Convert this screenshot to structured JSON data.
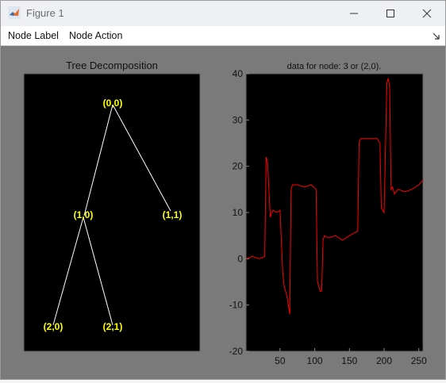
{
  "window": {
    "title": "Figure 1",
    "icon": "matlab-icon",
    "controls": [
      "minimize-icon",
      "maximize-icon",
      "close-icon"
    ]
  },
  "menu": {
    "items": [
      {
        "label": "Node Label"
      },
      {
        "label": "Node Action"
      }
    ],
    "dock_icon": "dock-arrow-icon"
  },
  "colors": {
    "figure_bg": "#7a7a7a",
    "axes_bg": "#000000",
    "node_label": "#ffff00",
    "tree_edge": "#ffffff",
    "signal": "#ff0000"
  },
  "tree": {
    "title": "Tree Decomposition",
    "nodes": [
      "(0,0)",
      "(1,0)",
      "(1,1)",
      "(2,0)",
      "(2,1)"
    ],
    "edges": [
      [
        "(0,0)",
        "(1,0)"
      ],
      [
        "(0,0)",
        "(1,1)"
      ],
      [
        "(1,0)",
        "(2,0)"
      ],
      [
        "(1,0)",
        "(2,1)"
      ]
    ]
  },
  "chart_data": {
    "type": "line",
    "title": "data for node: 3 or (2,0).",
    "xlabel": "",
    "ylabel": "",
    "xlim": [
      1,
      256
    ],
    "ylim": [
      -20,
      40
    ],
    "x_ticks": [
      50,
      100,
      150,
      200,
      250
    ],
    "y_ticks": [
      -20,
      -10,
      0,
      10,
      20,
      30,
      40
    ],
    "grid": false,
    "series": [
      {
        "color": "#ff0000",
        "x": [
          1,
          10,
          20,
          28,
          30,
          32,
          36,
          38,
          40,
          45,
          50,
          54,
          56,
          58,
          60,
          62,
          64,
          66,
          68,
          75,
          85,
          95,
          102,
          104,
          106,
          108,
          110,
          112,
          114,
          120,
          130,
          140,
          150,
          162,
          164,
          166,
          170,
          180,
          190,
          194,
          196,
          200,
          204,
          206,
          208,
          210,
          212,
          215,
          220,
          230,
          240,
          250,
          256
        ],
        "y": [
          0,
          0.5,
          0,
          0.5,
          22,
          21,
          9,
          10,
          10.5,
          10,
          10.5,
          -3,
          -6,
          -7,
          -8,
          -10,
          -12,
          15,
          16,
          16,
          15.5,
          16,
          15,
          -5,
          -6,
          -7,
          -7,
          4,
          5,
          4.5,
          5,
          4,
          5,
          6,
          25,
          26,
          26,
          26,
          26,
          25,
          11,
          10,
          38,
          39,
          37,
          15,
          15.5,
          14,
          15,
          14.5,
          15,
          16,
          17
        ]
      }
    ]
  }
}
